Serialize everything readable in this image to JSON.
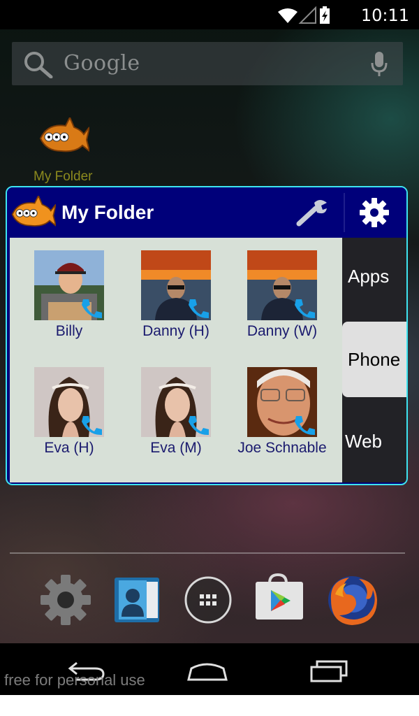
{
  "status_bar": {
    "time": "10:11",
    "icons": [
      "wifi-icon",
      "signal-icon",
      "battery-charging-icon"
    ]
  },
  "search": {
    "placeholder": "Google",
    "icon": "search-icon",
    "mic_icon": "mic-icon"
  },
  "desktop_folder": {
    "label": "My Folder",
    "icon": "fish-icon"
  },
  "folder_popup": {
    "title": "My Folder",
    "accent_border": "#3ee4f0",
    "header_color": "#00007a",
    "grid_color": "#d7e0d7",
    "header_icons": [
      "fish-icon",
      "wrench-icon",
      "gear-icon"
    ],
    "contacts": [
      {
        "name": "Billy"
      },
      {
        "name": "Danny (H)"
      },
      {
        "name": "Danny (W)"
      },
      {
        "name": "Eva (H)"
      },
      {
        "name": "Eva (M)"
      },
      {
        "name": "Joe Schnable"
      }
    ],
    "tabs": [
      {
        "label": "Apps",
        "active": false
      },
      {
        "label": "Phone",
        "active": true
      },
      {
        "label": "Web",
        "active": false
      }
    ]
  },
  "dock": {
    "items": [
      "settings-app-icon",
      "contacts-app-icon",
      "app-drawer-icon",
      "play-store-icon",
      "firefox-icon"
    ]
  },
  "nav_bar": {
    "buttons": [
      "back-button",
      "home-button",
      "recent-apps-button"
    ]
  },
  "watermark": "free for personal use"
}
